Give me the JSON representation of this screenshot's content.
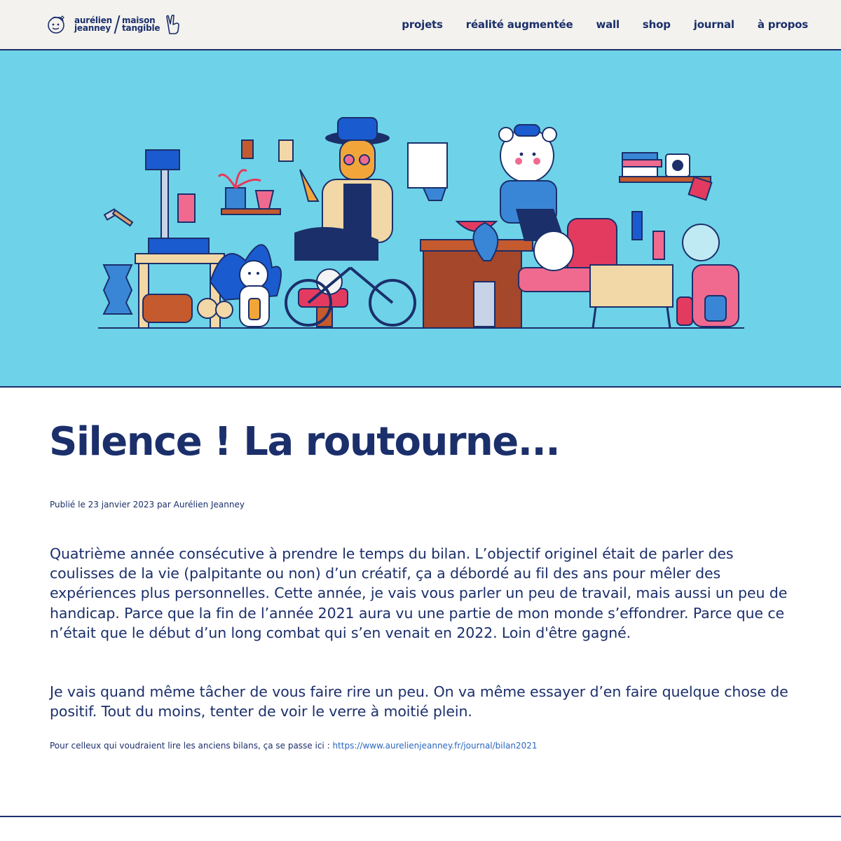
{
  "header": {
    "logo": {
      "line1a": "aurélien",
      "line1b": "jeanney",
      "line2a": "maison",
      "line2b": "tangible"
    },
    "nav": [
      {
        "label": "projets"
      },
      {
        "label": "réalité augmentée"
      },
      {
        "label": "wall"
      },
      {
        "label": "shop"
      },
      {
        "label": "journal"
      },
      {
        "label": "à propos"
      }
    ]
  },
  "colors": {
    "brand_navy": "#1b2f6b",
    "hero_background": "#6ed3e8",
    "header_background": "#f3f2ee",
    "link": "#2b67c0"
  },
  "hero": {
    "icon": "illustration-workshop-scene"
  },
  "article": {
    "title": "Silence ! La routourne...",
    "meta": "Publié le 23 janvier 2023 par Aurélien Jeanney",
    "paragraph1": "Quatrième année consécutive à prendre le temps du bilan. L’objectif originel était de parler des coulisses de la vie (palpitante ou non) d’un créatif, ça a débordé au fil des ans pour mêler des expériences plus personnelles. Cette année, je vais vous parler un peu de travail, mais aussi un peu de handicap. Parce que la fin de l’année 2021 aura vu une partie de mon monde s’effondrer. Parce que ce n’était que le début d’un long combat qui s’en venait en 2022. Loin d'être gagné.",
    "paragraph2": "Je vais quand même tâcher de vous faire rire un peu. On va même essayer d’en faire quelque chose de positif. Tout du moins, tenter de voir le verre à moitié plein.",
    "note_text": "Pour celleux qui voudraient lire les anciens bilans, ça se passe ici : ",
    "note_link": "https://www.aurelienjeanney.fr/journal/bilan2021"
  }
}
